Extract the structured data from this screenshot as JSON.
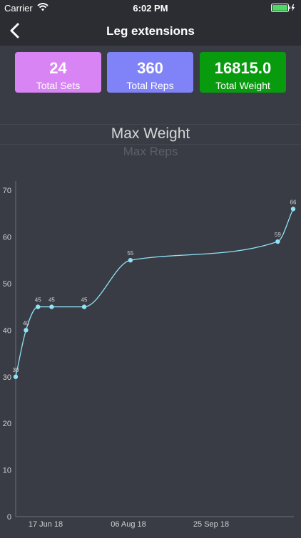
{
  "status_bar": {
    "carrier": "Carrier",
    "time": "6:02 PM"
  },
  "nav": {
    "title": "Leg extensions"
  },
  "stats": [
    {
      "value": "24",
      "label": "Total Sets",
      "color": "#d884f5"
    },
    {
      "value": "360",
      "label": "Total Reps",
      "color": "#8083f8"
    },
    {
      "value": "16815.0",
      "label": "Total Weight",
      "color": "#099b0e"
    }
  ],
  "chart_tabs": {
    "main": "Max Weight",
    "sub": "Max Reps"
  },
  "chart_data": {
    "type": "line",
    "title": "Max Weight",
    "xlabel": "",
    "ylabel": "",
    "ylim": [
      0,
      72
    ],
    "yticks": [
      0,
      10,
      20,
      30,
      40,
      50,
      60,
      70
    ],
    "xticks": [
      "17 Jun 18",
      "06 Aug 18",
      "25 Sep 18"
    ],
    "x": [
      "2018-05-31",
      "2018-06-06",
      "2018-06-13",
      "2018-06-21",
      "2018-07-10",
      "2018-08-06",
      "2018-10-31",
      "2018-11-09"
    ],
    "series": [
      {
        "values": [
          30,
          40,
          45,
          45,
          45,
          55,
          59,
          66
        ],
        "color": "#8fe3f7"
      }
    ],
    "point_labels": true,
    "grid": false
  }
}
